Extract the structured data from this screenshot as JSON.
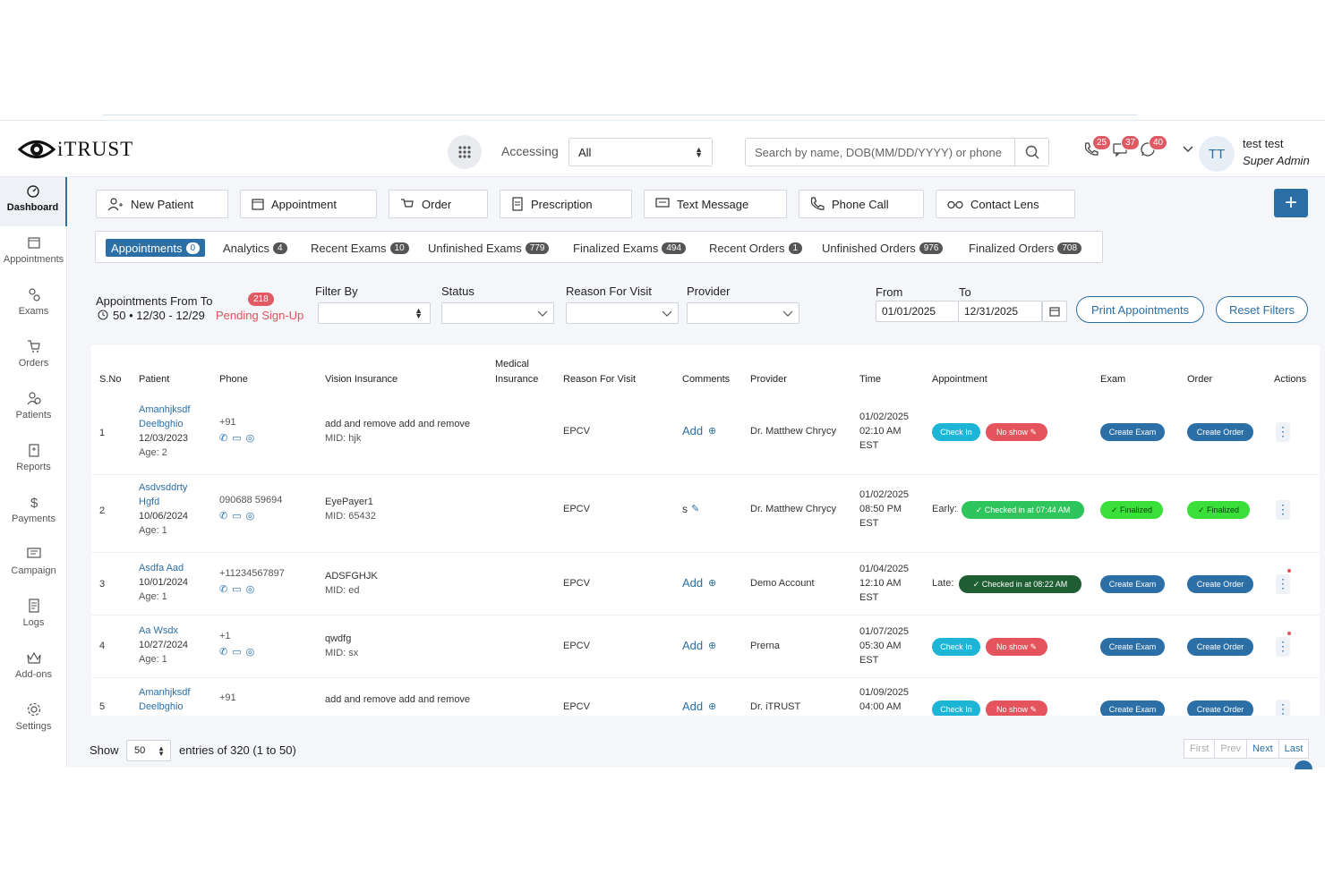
{
  "header": {
    "logo_text": "iTRUST",
    "accessing_label": "Accessing",
    "accessing_value": "All",
    "search_placeholder": "Search by name, DOB(MM/DD/YYYY) or phone",
    "notifications": {
      "calls": "25",
      "messages": "37",
      "whatsapp": "40"
    },
    "user": {
      "initials": "TT",
      "name": "test test",
      "role": "Super Admin"
    }
  },
  "sidebar": {
    "items": [
      {
        "label": "Dashboard",
        "icon": "dashboard-icon"
      },
      {
        "label": "Appointments",
        "icon": "calendar-icon"
      },
      {
        "label": "Exams",
        "icon": "exams-icon"
      },
      {
        "label": "Orders",
        "icon": "cart-icon"
      },
      {
        "label": "Patients",
        "icon": "patients-icon"
      },
      {
        "label": "Reports",
        "icon": "reports-icon"
      },
      {
        "label": "Payments",
        "icon": "dollar-icon"
      },
      {
        "label": "Campaign",
        "icon": "campaign-icon"
      },
      {
        "label": "Logs",
        "icon": "logs-icon"
      },
      {
        "label": "Add-ons",
        "icon": "crown-icon"
      },
      {
        "label": "Settings",
        "icon": "gear-icon"
      }
    ]
  },
  "actions": {
    "new_patient": "New Patient",
    "appointment": "Appointment",
    "order": "Order",
    "prescription": "Prescription",
    "text_message": "Text Message",
    "phone_call": "Phone Call",
    "contact_lens": "Contact Lens",
    "plus": "+"
  },
  "tabs": [
    {
      "label": "Appointments",
      "count": "0"
    },
    {
      "label": "Analytics",
      "count": "4"
    },
    {
      "label": "Recent Exams",
      "count": "10"
    },
    {
      "label": "Unfinished Exams",
      "count": "779"
    },
    {
      "label": "Finalized Exams",
      "count": "494"
    },
    {
      "label": "Recent Orders",
      "count": "1"
    },
    {
      "label": "Unfinished Orders",
      "count": "976"
    },
    {
      "label": "Finalized Orders",
      "count": "708"
    }
  ],
  "filters": {
    "appointments_from_to": "Appointments From To",
    "summary": "50 • 12/30 - 12/29",
    "pending_count": "218",
    "pending_label": "Pending Sign-Up",
    "filter_by": "Filter By",
    "status": "Status",
    "reason": "Reason For Visit",
    "provider": "Provider",
    "from": "From",
    "to": "To",
    "from_value": "01/01/2025",
    "to_value": "12/31/2025",
    "print_btn": "Print Appointments",
    "reset_btn": "Reset Filters"
  },
  "table": {
    "headers": {
      "sno": "S.No",
      "patient": "Patient",
      "phone": "Phone",
      "vision": "Vision Insurance",
      "medical_1": "Medical",
      "medical_2": "Insurance",
      "reason": "Reason For Visit",
      "comments": "Comments",
      "provider": "Provider",
      "time": "Time",
      "appointment": "Appointment",
      "exam": "Exam",
      "order": "Order",
      "actions": "Actions"
    },
    "rows": [
      {
        "sno": "1",
        "name1": "Amanhjksdf",
        "name2": "Deelbghio",
        "dob": "12/03/2023",
        "age": "Age: 2",
        "phone": "+91",
        "vision": "add and remove add and remove",
        "mid": "MID: hjk",
        "reason": "EPCV",
        "comment": "Add",
        "provider": "Dr. Matthew Chrycy",
        "date": "01/02/2025",
        "time": "02:10 AM",
        "tz": "EST"
      },
      {
        "sno": "2",
        "name1": "Asdvsddrty",
        "name2": "Hgfd",
        "dob": "10/06/2024",
        "age": "Age: 1",
        "phone": "090688 59694",
        "vision": "EyePayer1",
        "mid": "MID: 65432",
        "reason": "EPCV",
        "comment": "s",
        "provider": "Dr. Matthew Chrycy",
        "date": "01/02/2025",
        "time": "08:50 PM",
        "tz": "EST",
        "early": "Early:",
        "checked": "Checked in at 07:44 AM",
        "exam_status": "Finalized",
        "order_status": "Finalized"
      },
      {
        "sno": "3",
        "name1": "Asdfa Aad",
        "dob": "10/01/2024",
        "age": "Age: 1",
        "phone": "+11234567897",
        "vision": "ADSFGHJK",
        "mid": "MID: ed",
        "reason": "EPCV",
        "comment": "Add",
        "provider": "Demo Account",
        "date": "01/04/2025",
        "time": "12:10 AM",
        "tz": "EST",
        "late": "Late:",
        "checked": "Checked in at 08:22 AM"
      },
      {
        "sno": "4",
        "name1": "Aa Wsdx",
        "dob": "10/27/2024",
        "age": "Age: 1",
        "phone": "+1",
        "vision": "qwdfg",
        "mid": "MID: sx",
        "reason": "EPCV",
        "comment": "Add",
        "provider": "Prerna",
        "date": "01/07/2025",
        "time": "05:30 AM",
        "tz": "EST"
      },
      {
        "sno": "5",
        "name1": "Amanhjksdf",
        "name2": "Deelbghio",
        "phone": "+91",
        "vision": "add and remove add and remove",
        "reason": "EPCV",
        "comment": "Add",
        "provider": "Dr. iTRUST",
        "date": "01/09/2025",
        "time": "04:00 AM"
      }
    ],
    "buttons": {
      "check_in": "Check In",
      "no_show": "No show",
      "create_exam": "Create Exam",
      "create_order": "Create Order"
    }
  },
  "footer": {
    "show": "Show",
    "page_size": "50",
    "entries": "entries of 320 (1 to 50)",
    "first": "First",
    "prev": "Prev",
    "next": "Next",
    "last": "Last"
  },
  "colors": {
    "primary": "#2c6fa6",
    "danger": "#e5545d",
    "info": "#1cb5d6",
    "success": "#2ec65c"
  }
}
